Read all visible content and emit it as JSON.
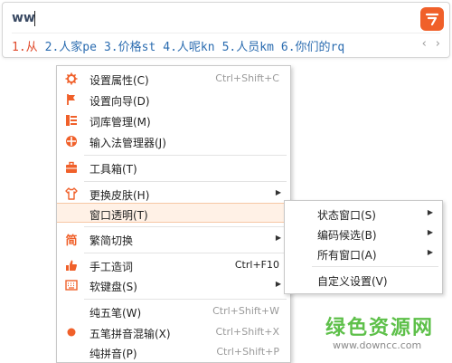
{
  "ime": {
    "input": "ww",
    "logo_text": "",
    "candidates": [
      "1.从",
      "2.人家pe",
      "3.价格st",
      "4.人呢kn",
      "5.人员km",
      "6.你们的rq"
    ],
    "prev": "‹",
    "next": "›"
  },
  "menu": {
    "items": [
      {
        "label": "设置属性(C)",
        "shortcut": "Ctrl+Shift+C",
        "icon": "gear-icon"
      },
      {
        "label": "设置向导(D)",
        "shortcut": "",
        "icon": "flag-icon"
      },
      {
        "label": "词库管理(M)",
        "shortcut": "",
        "icon": "dictionary-icon"
      },
      {
        "label": "输入法管理器(J)",
        "shortcut": "",
        "icon": "ime-manager-icon"
      },
      {
        "label": "工具箱(T)",
        "shortcut": "",
        "icon": "toolbox-icon"
      },
      {
        "label": "更换皮肤(H)",
        "shortcut": "",
        "icon": "shirt-icon"
      },
      {
        "label": "窗口透明(T)",
        "shortcut": "",
        "icon": ""
      },
      {
        "label": "繁简切换",
        "shortcut": "",
        "icon": "traditional-icon"
      },
      {
        "label": "手工造词",
        "shortcut": "Ctrl+F10",
        "icon": "hand-icon"
      },
      {
        "label": "软键盘(S)",
        "shortcut": "",
        "icon": "keyboard-icon"
      },
      {
        "label": "纯五笔(W)",
        "shortcut": "Ctrl+Shift+W",
        "icon": ""
      },
      {
        "label": "五笔拼音混输(X)",
        "shortcut": "Ctrl+Shift+X",
        "icon": "dot-icon"
      },
      {
        "label": "纯拼音(P)",
        "shortcut": "Ctrl+Shift+P",
        "icon": ""
      }
    ]
  },
  "submenu": {
    "items": [
      {
        "label": "状态窗口(S)"
      },
      {
        "label": "编码候选(B)"
      },
      {
        "label": "所有窗口(A)"
      },
      {
        "label": "自定义设置(V)"
      }
    ]
  },
  "watermark": {
    "title": "绿色资源网",
    "url": "www.downcc.com"
  },
  "colors": {
    "accent": "#f0602a",
    "candidate": "#2b6cb0",
    "candidate_first": "#e0492a",
    "highlight_bg": "#fff1e6",
    "watermark": "#5ec04a"
  }
}
